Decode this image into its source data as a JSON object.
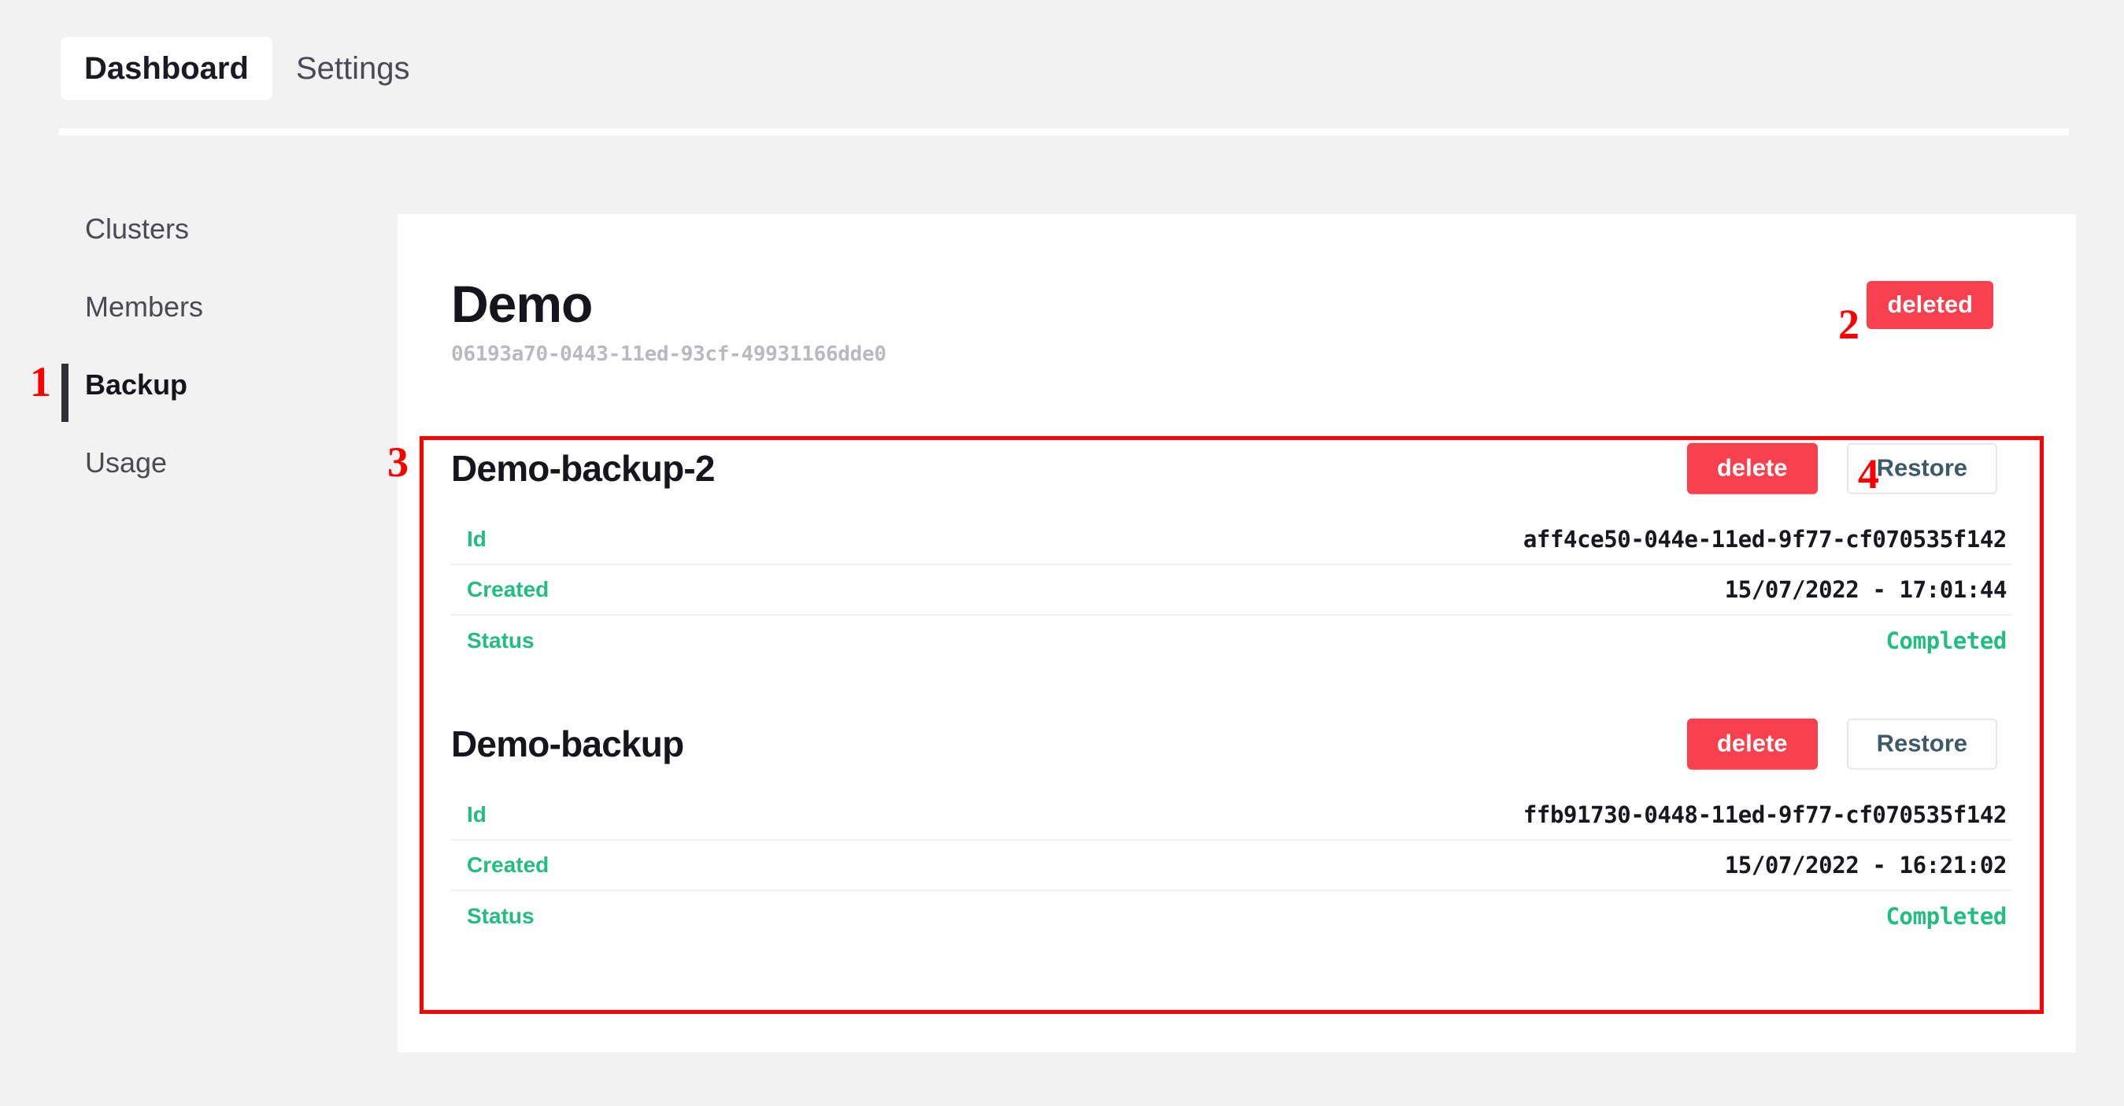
{
  "colors": {
    "page_background": "#f2f2f2",
    "panel_background": "#ffffff",
    "accent_red": "#f8404e",
    "accent_green": "#23bd80",
    "annotation_red": "#fc0000",
    "text_dark": "#15151e",
    "text_muted": "#4a4a55",
    "uuid_gray": "#b9b9bf",
    "restore_text": "#3d5a66"
  },
  "topnav": {
    "tabs": [
      {
        "label": "Dashboard",
        "active": true
      },
      {
        "label": "Settings",
        "active": false
      }
    ]
  },
  "sidebar": {
    "items": [
      {
        "label": "Clusters",
        "active": false
      },
      {
        "label": "Members",
        "active": false
      },
      {
        "label": "Backup",
        "active": true
      },
      {
        "label": "Usage",
        "active": false
      }
    ]
  },
  "cluster": {
    "title": "Demo",
    "uuid": "06193a70-0443-11ed-93cf-49931166dde0",
    "status_badge": "deleted"
  },
  "actions": {
    "delete_label": "delete",
    "restore_label": "Restore"
  },
  "detail_labels": {
    "id": "Id",
    "created": "Created",
    "status": "Status"
  },
  "backups": [
    {
      "name": "Demo-backup-2",
      "id": "aff4ce50-044e-11ed-9f77-cf070535f142",
      "created": "15/07/2022 - 17:01:44",
      "status": "Completed",
      "delete_label": "delete",
      "restore_label": "Restore"
    },
    {
      "name": "Demo-backup",
      "id": "ffb91730-0448-11ed-9f77-cf070535f142",
      "created": "15/07/2022 - 16:21:02",
      "status": "Completed",
      "delete_label": "delete",
      "restore_label": "Restore"
    }
  ],
  "annotations": {
    "marker_1": "1",
    "marker_2": "2",
    "marker_3": "3",
    "marker_4": "4"
  }
}
